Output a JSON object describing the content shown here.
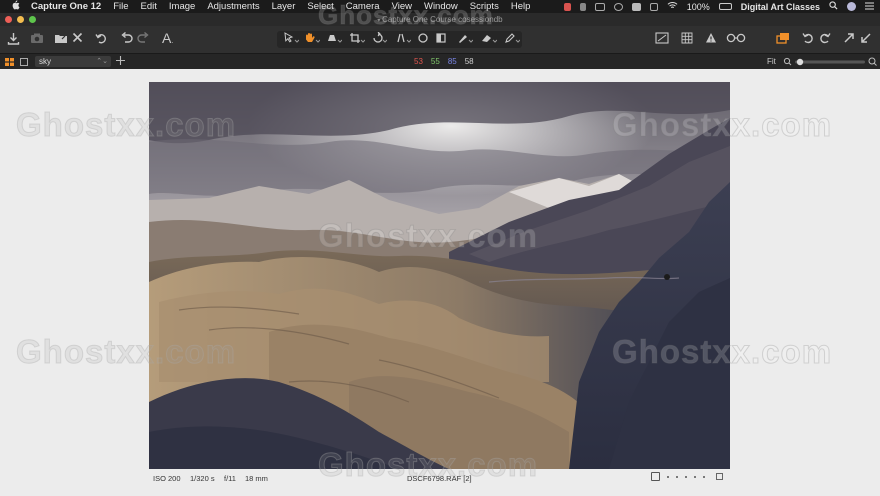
{
  "menubar": {
    "items": [
      "Capture One 12",
      "File",
      "Edit",
      "Image",
      "Adjustments",
      "Layer",
      "Select",
      "Camera",
      "View",
      "Window",
      "Scripts",
      "Help"
    ],
    "battery": "100%",
    "account": "Digital Art Classes"
  },
  "window": {
    "title": "Capture One Course cosessiondb"
  },
  "subbar": {
    "layer_select": "sky",
    "rgb": {
      "r": "53",
      "g": "55",
      "b": "85",
      "l": "58"
    },
    "zoom_label": "Fit"
  },
  "photo_meta": {
    "iso": "ISO 200",
    "shutter": "1/320 s",
    "aperture": "f/11",
    "focal": "18 mm",
    "filename": "DSCF6798.RAF [2]"
  },
  "watermark": "Ghostxx.com",
  "colors": {
    "menubar_bg": "#1b1b1b",
    "toolbar_bg": "#303030",
    "viewer_bg": "#ececec",
    "accent_orange": "#f0902a",
    "rgb_r": "#e0564f",
    "rgb_g": "#7fc56a",
    "rgb_b": "#7a86e6"
  },
  "icons": [
    "apple-icon",
    "import-icon",
    "camera-icon",
    "export-icon",
    "delete-icon",
    "reset-icon",
    "undo-icon",
    "redo-icon",
    "text-icon",
    "cursor-tool-icon",
    "hand-pan-icon",
    "layer-tool-icon",
    "crop-icon",
    "rotate-icon",
    "keystone-icon",
    "circle-icon",
    "brush-icon",
    "eraser-icon",
    "gradient-icon",
    "compare-icon",
    "grid-icon",
    "warning-icon",
    "loupe-icon",
    "layers-icon",
    "rotate-left-icon",
    "rotate-right-icon",
    "expand-icon",
    "collapse-icon",
    "search-icon",
    "user-icon",
    "list-icon"
  ]
}
